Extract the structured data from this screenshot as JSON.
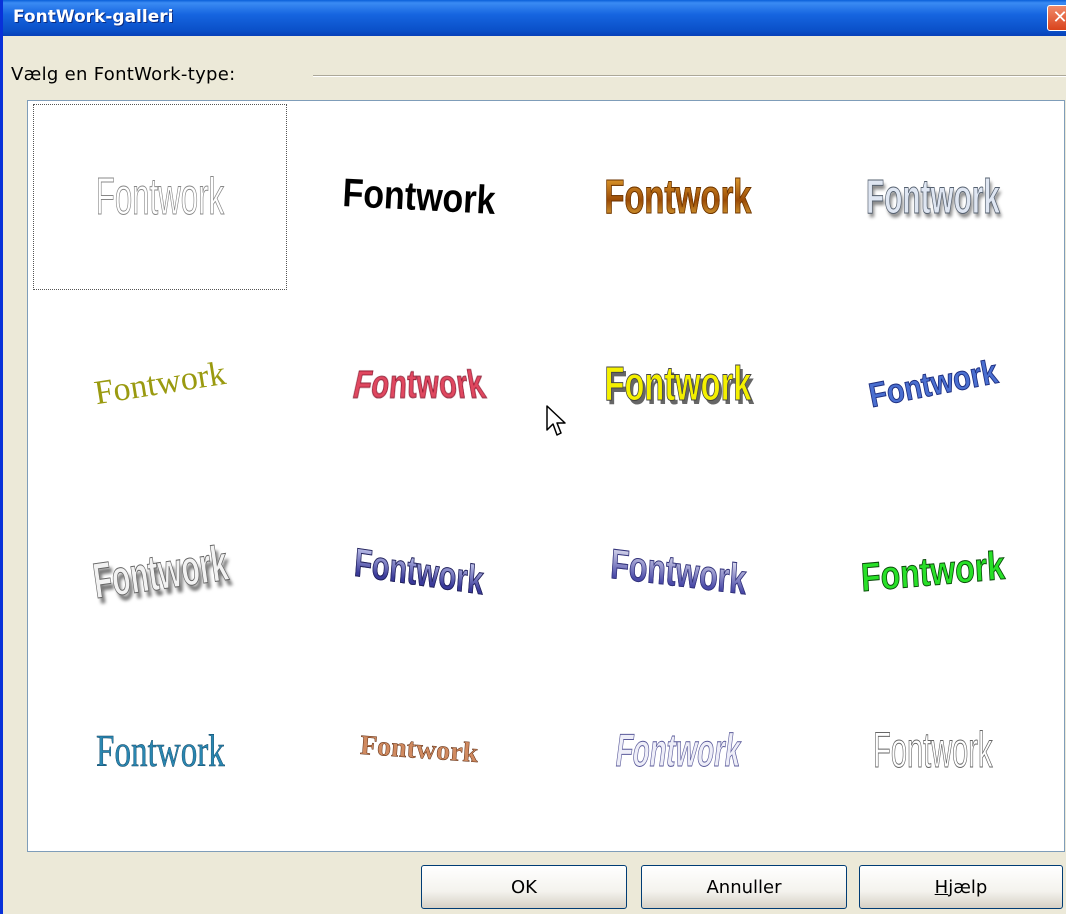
{
  "window": {
    "title": "FontWork-galleri",
    "close_glyph": "✕"
  },
  "gallery": {
    "label": "Vælg en FontWork-type:",
    "selected_index": 0,
    "items": [
      {
        "text": "Fontwork",
        "style": "outline-gray"
      },
      {
        "text": "Fontwork",
        "style": "black-arc"
      },
      {
        "text": "Fontwork",
        "style": "brown-gold"
      },
      {
        "text": "Fontwork",
        "style": "gray-shadow"
      },
      {
        "text": "Fontwork",
        "style": "olive-slant"
      },
      {
        "text": "Fontwork",
        "style": "pink-perspective"
      },
      {
        "text": "Fontwork",
        "style": "yellow-shadow"
      },
      {
        "text": "Fontwork",
        "style": "blue-tilt"
      },
      {
        "text": "Fontwork",
        "style": "gray-3d"
      },
      {
        "text": "Fontwork",
        "style": "blue-gradient"
      },
      {
        "text": "Fontwork",
        "style": "blue-gradient-light"
      },
      {
        "text": "Fontwork",
        "style": "green-arc"
      },
      {
        "text": "Fontwork",
        "style": "teal-serif"
      },
      {
        "text": "Fontwork",
        "style": "brown-arc"
      },
      {
        "text": "Fontwork",
        "style": "lavender-outline"
      },
      {
        "text": "Fontwork",
        "style": "outline-thin"
      }
    ]
  },
  "buttons": {
    "ok": "OK",
    "cancel": "Annuller",
    "help_accel": "H",
    "help_rest": "jælp"
  },
  "colors": {
    "titlebar": "#0a50c8",
    "dialog_bg": "#ece9d8",
    "gallery_bg": "#ffffff"
  }
}
